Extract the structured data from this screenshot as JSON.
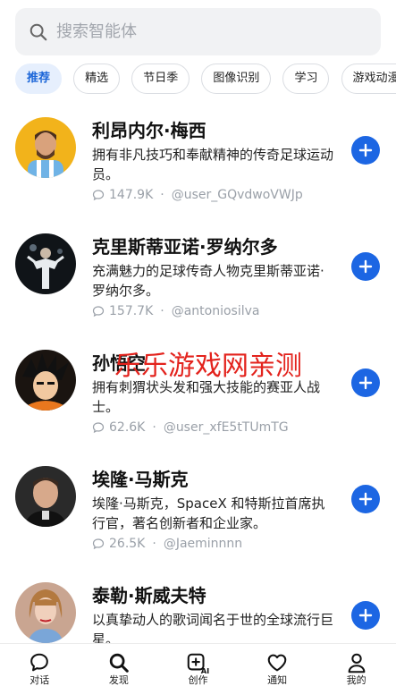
{
  "search": {
    "placeholder": "搜索智能体",
    "value": ""
  },
  "chips": [
    "推荐",
    "精选",
    "节日季",
    "图像识别",
    "学习",
    "游戏动漫"
  ],
  "bots": [
    {
      "name": "利昂内尔·梅西",
      "desc": "拥有非凡技巧和奉献精神的传奇足球运动员。",
      "chats": "147.9K",
      "author": "@user_GQvdwoVWJp",
      "avatar": "soccer-player-avatar"
    },
    {
      "name": "克里斯蒂亚诺·罗纳尔多",
      "desc": "充满魅力的足球传奇人物克里斯蒂亚诺·罗纳尔多。",
      "chats": "157.7K",
      "author": "@antoniosilva",
      "avatar": "soccer-player-dark-avatar"
    },
    {
      "name": "孙悟空",
      "desc": "拥有刺猬状头发和强大技能的赛亚人战士。",
      "chats": "62.6K",
      "author": "@user_xfE5tTUmTG",
      "avatar": "anime-warrior-avatar"
    },
    {
      "name": "埃隆·马斯克",
      "desc": "埃隆·马斯克，SpaceX 和特斯拉首席执行官，著名创新者和企业家。",
      "chats": "26.5K",
      "author": "@Jaeminnnn",
      "avatar": "businessman-avatar"
    },
    {
      "name": "泰勒·斯威夫特",
      "desc": "以真挚动人的歌词闻名于世的全球流行巨星。",
      "chats": "",
      "author": "",
      "avatar": "singer-avatar"
    }
  ],
  "watermark": "乐乐游戏网亲测",
  "tabs": [
    {
      "label": "对话",
      "icon": "chat-icon"
    },
    {
      "label": "发现",
      "icon": "search-icon"
    },
    {
      "label": "创作",
      "icon": "create-ai-icon"
    },
    {
      "label": "通知",
      "icon": "heart-icon"
    },
    {
      "label": "我的",
      "icon": "profile-icon"
    }
  ],
  "colors": {
    "accent": "#1c66e3",
    "chip_active_bg": "#e6effd",
    "watermark": "#e3231d"
  }
}
